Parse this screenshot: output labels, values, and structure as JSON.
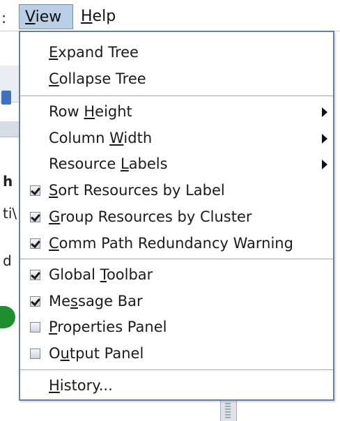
{
  "menubar": {
    "partial_label": ":",
    "items": [
      {
        "label": "View",
        "mnemonic": "V",
        "rest": "iew"
      },
      {
        "label": "Help",
        "mnemonic": "H",
        "rest": "elp"
      }
    ]
  },
  "background": {
    "partial_h": "h",
    "partial_t": "ti\\",
    "partial_d": "d"
  },
  "menu": {
    "items": [
      {
        "pre": "",
        "mn": "E",
        "post": "xpand Tree",
        "type": "normal"
      },
      {
        "pre": "",
        "mn": "C",
        "post": "ollapse Tree",
        "type": "normal"
      },
      {
        "pre": "Row ",
        "mn": "H",
        "post": "eight",
        "type": "submenu"
      },
      {
        "pre": "Column ",
        "mn": "W",
        "post": "idth",
        "type": "submenu"
      },
      {
        "pre": "Resource ",
        "mn": "L",
        "post": "abels",
        "type": "submenu"
      },
      {
        "pre": "",
        "mn": "S",
        "post": "ort Resources by Label",
        "type": "check",
        "checked": true
      },
      {
        "pre": "",
        "mn": "G",
        "post": "roup Resources by Cluster",
        "type": "check",
        "checked": true
      },
      {
        "pre": "",
        "mn": "C",
        "post": "omm Path Redundancy Warning",
        "type": "check",
        "checked": true
      },
      {
        "pre": "Global ",
        "mn": "T",
        "post": "oolbar",
        "type": "check",
        "checked": true
      },
      {
        "pre": "Me",
        "mn": "s",
        "post": "sage Bar",
        "type": "check",
        "checked": true
      },
      {
        "pre": "",
        "mn": "P",
        "post": "roperties Panel",
        "type": "check",
        "checked": false
      },
      {
        "pre": "O",
        "mn": "u",
        "post": "tput Panel",
        "type": "check",
        "checked": false
      },
      {
        "pre": "",
        "mn": "H",
        "post": "istory...",
        "type": "normal"
      }
    ]
  }
}
